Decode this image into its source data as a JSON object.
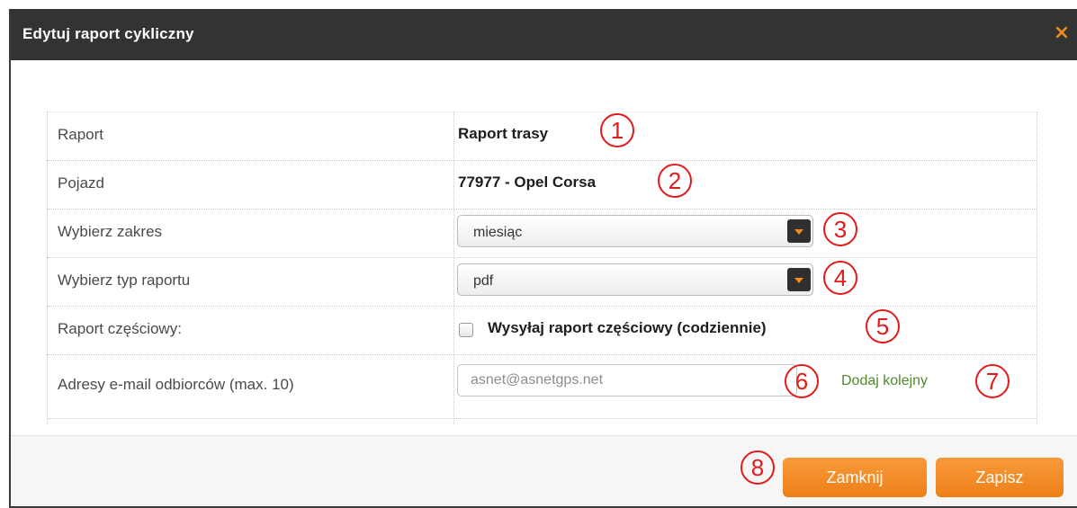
{
  "dialog": {
    "title": "Edytuj raport cykliczny",
    "close_icon": "×"
  },
  "form": {
    "report_label": "Raport",
    "report_value": "Raport trasy",
    "vehicle_label": "Pojazd",
    "vehicle_value": "77977 - Opel Corsa",
    "range_label": "Wybierz zakres",
    "range_value": "miesiąc",
    "type_label": "Wybierz typ raportu",
    "type_value": "pdf",
    "partial_label": "Raport częściowy:",
    "partial_checkbox_label": "Wysyłaj raport częściowy (codziennie)",
    "partial_checked": false,
    "emails_label": "Adresy e-mail odbiorców (max. 10)",
    "email_placeholder": "asnet@asnetgps.net",
    "add_more_label": "Dodaj kolejny"
  },
  "footer": {
    "close_label": "Zamknij",
    "save_label": "Zapisz"
  },
  "markers": [
    "1",
    "2",
    "3",
    "4",
    "5",
    "6",
    "7",
    "8"
  ],
  "colors": {
    "titlebar": "#333333",
    "accent": "#f28a1e",
    "link": "#4f8a2a",
    "marker": "#e11b1b"
  }
}
